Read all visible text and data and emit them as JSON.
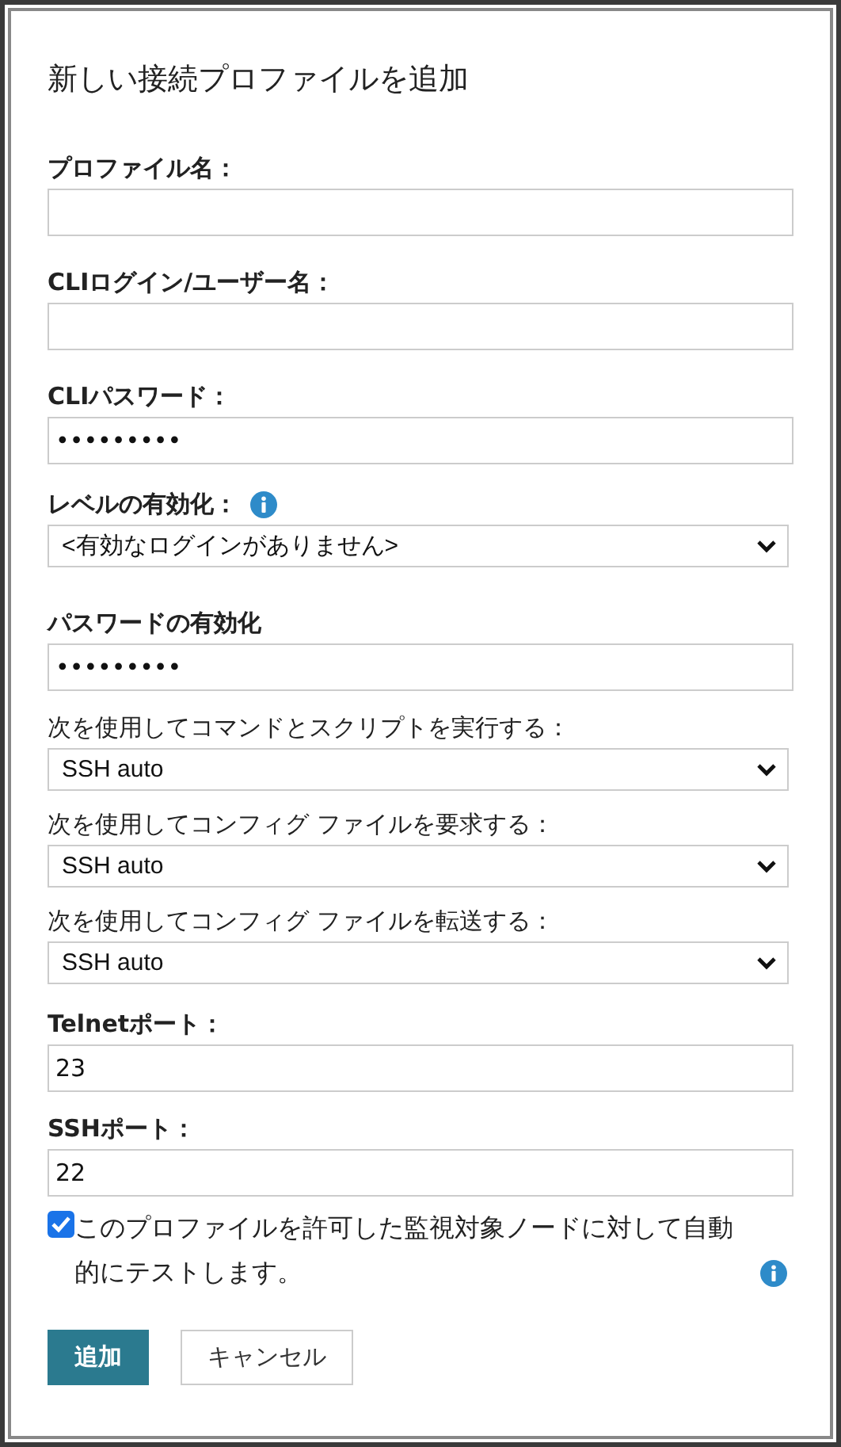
{
  "dialog": {
    "title": "新しい接続プロファイルを追加"
  },
  "fields": [
    {
      "kind": "text",
      "label": "プロファイル名：",
      "bold": true,
      "info": false
    },
    {
      "kind": "text",
      "label": "CLIログイン/ユーザー名：",
      "bold": true,
      "info": false
    },
    {
      "kind": "password",
      "label": "CLIパスワード：",
      "bold": true,
      "info": false,
      "value": "•••••••••"
    },
    {
      "kind": "select",
      "label": "レベルの有効化：",
      "bold": true,
      "info": true,
      "value": "<有効なログインがありません>"
    },
    {
      "kind": "password",
      "label": "パスワードの有効化",
      "bold": true,
      "info": false,
      "value": "•••••••••"
    },
    {
      "kind": "select",
      "label": "次を使用してコマンドとスクリプトを実行する：",
      "bold": false,
      "info": false,
      "value": "SSH auto"
    },
    {
      "kind": "select",
      "label": "次を使用してコンフィグ ファイルを要求する：",
      "bold": false,
      "info": false,
      "value": "SSH auto"
    },
    {
      "kind": "select",
      "label": "次を使用してコンフィグ ファイルを転送する：",
      "bold": false,
      "info": false,
      "value": "SSH auto"
    },
    {
      "kind": "text",
      "label": "Telnetポート：",
      "bold": true,
      "info": false,
      "value": "23"
    },
    {
      "kind": "text",
      "label": "SSHポート：",
      "bold": true,
      "info": false,
      "value": "22"
    }
  ],
  "auto_test": {
    "checked": true,
    "label": "このプロファイルを許可した監視対象ノードに対して自動的にテストします。"
  },
  "buttons": [
    {
      "kind": "primary",
      "label": "追加"
    },
    {
      "kind": "secondary",
      "label": "キャンセル"
    }
  ]
}
